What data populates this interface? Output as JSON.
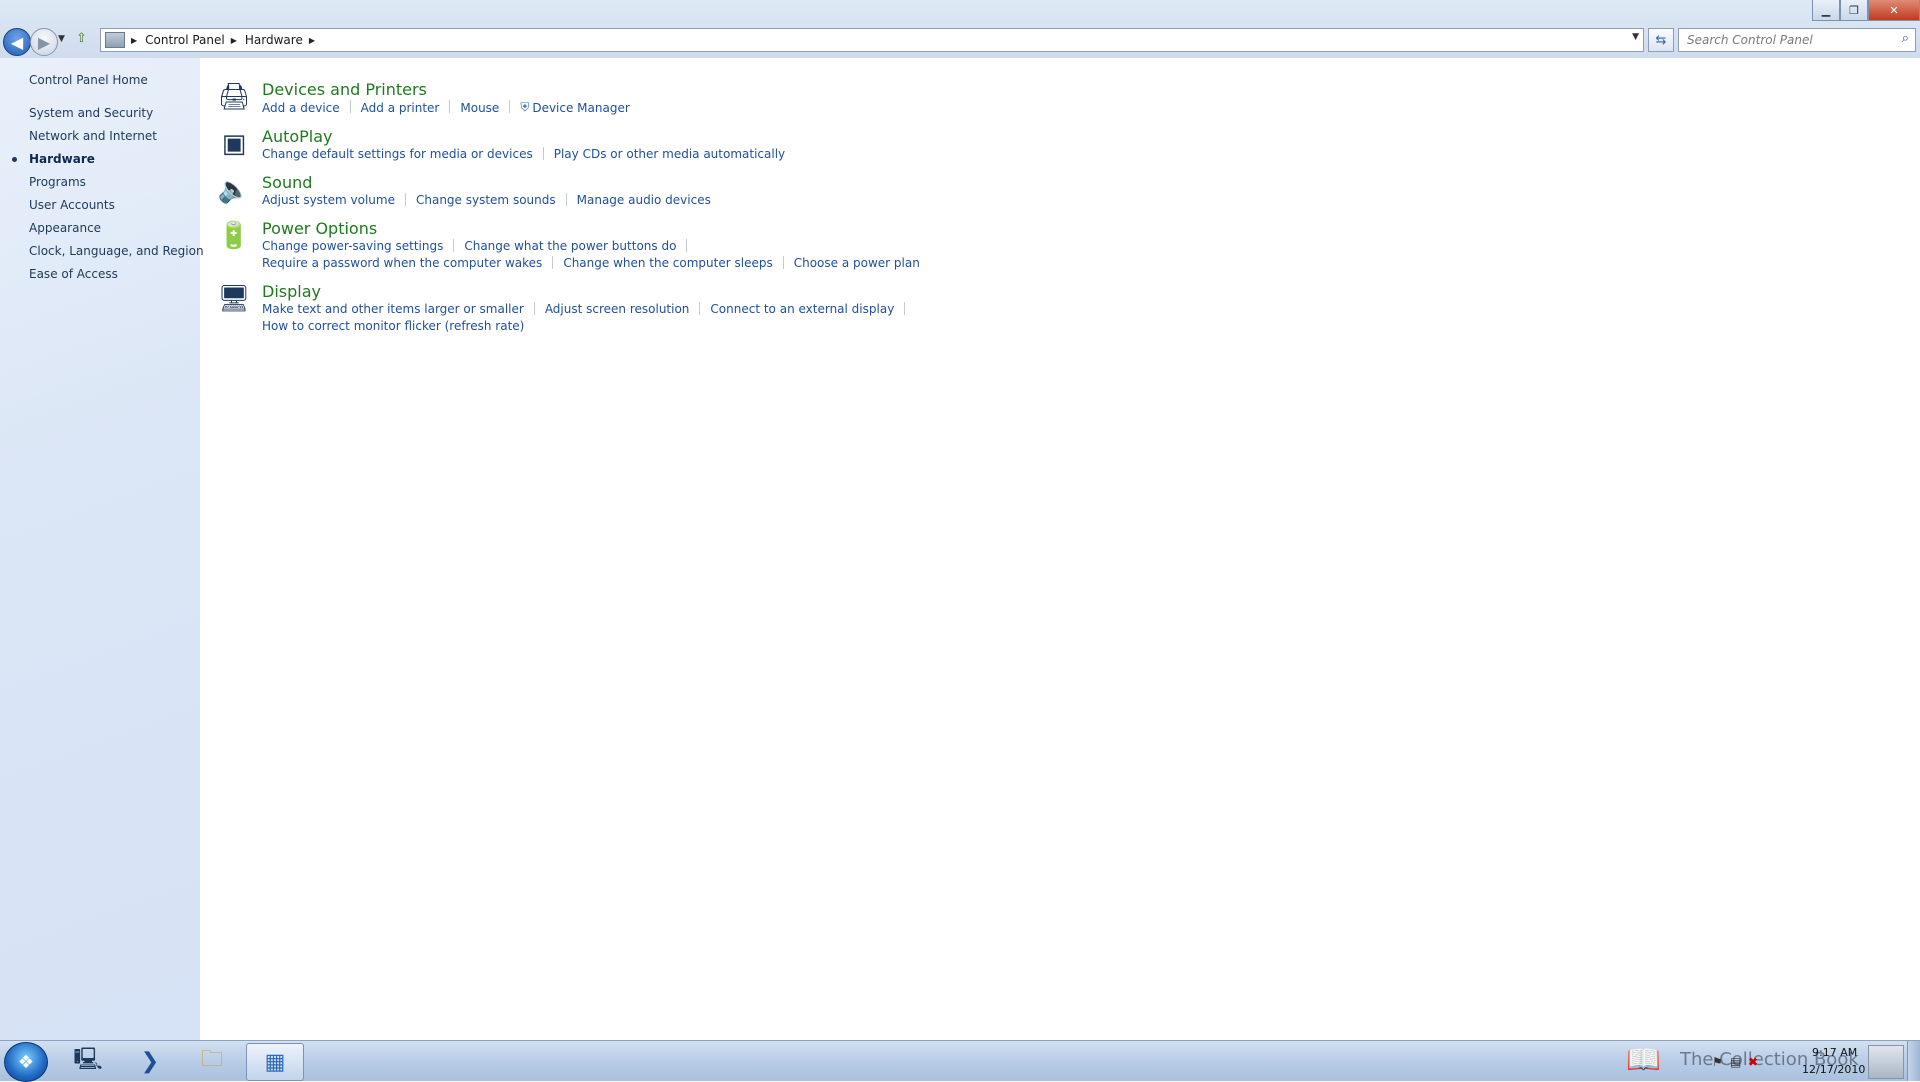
{
  "window": {
    "minimize_label": "▁",
    "restore_label": "❐",
    "close_label": "✕"
  },
  "breadcrumb": {
    "items": [
      "Control Panel",
      "Hardware"
    ]
  },
  "search": {
    "placeholder": "Search Control Panel"
  },
  "sidebar": {
    "items": [
      {
        "label": "Control Panel Home"
      },
      {
        "label": "System and Security"
      },
      {
        "label": "Network and Internet"
      },
      {
        "label": "Hardware",
        "current": true
      },
      {
        "label": "Programs"
      },
      {
        "label": "User Accounts"
      },
      {
        "label": "Appearance"
      },
      {
        "label": "Clock, Language, and Region"
      },
      {
        "label": "Ease of Access"
      }
    ]
  },
  "categories": [
    {
      "title": "Devices and Printers",
      "icon": "printer-icon",
      "rows": [
        [
          "Add a device",
          "Add a printer",
          "Mouse",
          "Device Manager"
        ]
      ]
    },
    {
      "title": "AutoPlay",
      "icon": "autoplay-icon",
      "rows": [
        [
          "Change default settings for media or devices",
          "Play CDs or other media automatically"
        ]
      ]
    },
    {
      "title": "Sound",
      "icon": "speaker-icon",
      "rows": [
        [
          "Adjust system volume",
          "Change system sounds",
          "Manage audio devices"
        ]
      ]
    },
    {
      "title": "Power Options",
      "icon": "battery-icon",
      "rows": [
        [
          "Change power-saving settings",
          "Change what the power buttons do"
        ],
        [
          "Require a password when the computer wakes",
          "Change when the computer sleeps",
          "Choose a power plan"
        ]
      ]
    },
    {
      "title": "Display",
      "icon": "monitor-icon",
      "rows": [
        [
          "Make text and other items larger or smaller",
          "Adjust screen resolution",
          "Connect to an external display"
        ],
        [
          "How to correct monitor flicker (refresh rate)"
        ]
      ]
    }
  ],
  "taskbar": {
    "watermark": "The Collection Book",
    "time": "9:17 AM",
    "date": "12/17/2010"
  }
}
